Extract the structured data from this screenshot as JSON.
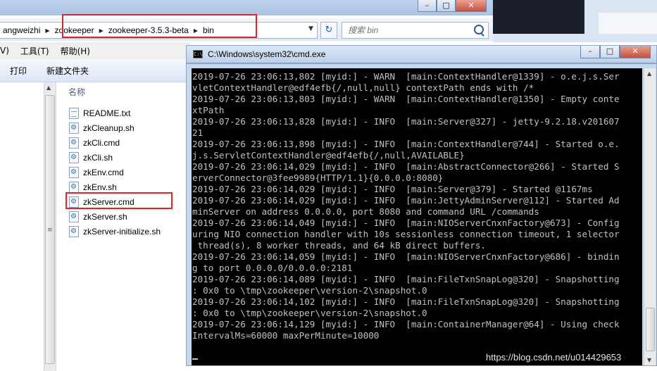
{
  "explorer": {
    "breadcrumbs": [
      "angweizhi",
      "zookeeper",
      "zookeeper-3.5.3-beta",
      "bin"
    ],
    "search_placeholder": "搜索 bin",
    "menu": [
      "V)",
      "工具(T)",
      "帮助(H)"
    ],
    "toolbar": [
      "打印",
      "新建文件夹"
    ],
    "column_name": "名称",
    "files": [
      {
        "name": "README.txt",
        "icon": "text-file-icon"
      },
      {
        "name": "zkCleanup.sh",
        "icon": "script-file-icon"
      },
      {
        "name": "zkCli.cmd",
        "icon": "script-file-icon"
      },
      {
        "name": "zkCli.sh",
        "icon": "script-file-icon"
      },
      {
        "name": "zkEnv.cmd",
        "icon": "script-file-icon"
      },
      {
        "name": "zkEnv.sh",
        "icon": "script-file-icon"
      },
      {
        "name": "zkServer.cmd",
        "icon": "script-file-icon"
      },
      {
        "name": "zkServer.sh",
        "icon": "script-file-icon"
      },
      {
        "name": "zkServer-initialize.sh",
        "icon": "script-file-icon"
      }
    ],
    "highlighted_file": "zkServer.cmd"
  },
  "cmd": {
    "title": "C:\\Windows\\system32\\cmd.exe",
    "lines": [
      "2019-07-26 23:06:13,802 [myid:] - WARN  [main:ContextHandler@1339] - o.e.j.s.Ser",
      "vletContextHandler@edf4efb{/,null,null} contextPath ends with /*",
      "2019-07-26 23:06:13,803 [myid:] - WARN  [main:ContextHandler@1350] - Empty conte",
      "xtPath",
      "2019-07-26 23:06:13,828 [myid:] - INFO  [main:Server@327] - jetty-9.2.18.v201607",
      "21",
      "2019-07-26 23:06:13,898 [myid:] - INFO  [main:ContextHandler@744] - Started o.e.",
      "j.s.ServletContextHandler@edf4efb{/,null,AVAILABLE}",
      "2019-07-26 23:06:14,029 [myid:] - INFO  [main:AbstractConnector@266] - Started S",
      "erverConnector@3fee9989{HTTP/1.1}{0.0.0.0:8080}",
      "2019-07-26 23:06:14,029 [myid:] - INFO  [main:Server@379] - Started @1167ms",
      "2019-07-26 23:06:14,029 [myid:] - INFO  [main:JettyAdminServer@112] - Started Ad",
      "minServer on address 0.0.0.0, port 8080 and command URL /commands",
      "2019-07-26 23:06:14,049 [myid:] - INFO  [main:NIOServerCnxnFactory@673] - Config",
      "uring NIO connection handler with 10s sessionless connection timeout, 1 selector",
      " thread(s), 8 worker threads, and 64 kB direct buffers.",
      "2019-07-26 23:06:14,059 [myid:] - INFO  [main:NIOServerCnxnFactory@686] - bindin",
      "g to port 0.0.0.0/0.0.0.0:2181",
      "2019-07-26 23:06:14,089 [myid:] - INFO  [main:FileTxnSnapLog@320] - Snapshotting",
      ": 0x0 to \\tmp\\zookeeper\\version-2\\snapshot.0",
      "2019-07-26 23:06:14,102 [myid:] - INFO  [main:FileTxnSnapLog@320] - Snapshotting",
      ": 0x0 to \\tmp\\zookeeper\\version-2\\snapshot.0",
      "2019-07-26 23:06:14,129 [myid:] - INFO  [main:ContainerManager@64] - Using check",
      "IntervalMs=60000 maxPerMinute=10000",
      ""
    ]
  },
  "watermark": "https://blog.csdn.net/u014429653"
}
